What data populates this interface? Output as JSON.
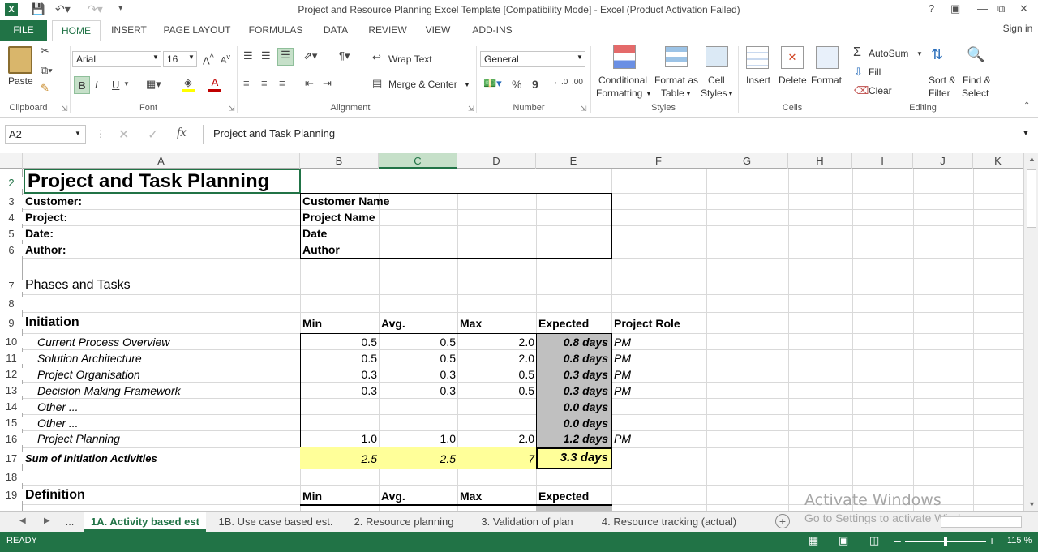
{
  "window": {
    "title": "Project and Resource Planning Excel Template  [Compatibility Mode] - Excel (Product Activation Failed)",
    "help": "?",
    "sign_in": "Sign in"
  },
  "ribbon_tabs": [
    "FILE",
    "HOME",
    "INSERT",
    "PAGE LAYOUT",
    "FORMULAS",
    "DATA",
    "REVIEW",
    "VIEW",
    "ADD-INS"
  ],
  "ribbon": {
    "paste": "Paste",
    "font_name": "Arial",
    "font_size": "16",
    "bold": "B",
    "italic": "I",
    "underline": "U",
    "wrap_text": "Wrap Text",
    "merge_center": "Merge & Center",
    "number_format": "General",
    "percent": "%",
    "comma": "9",
    "cond_fmt": [
      "Conditional",
      "Formatting"
    ],
    "fmt_table": [
      "Format as",
      "Table"
    ],
    "cell_styles": [
      "Cell",
      "Styles"
    ],
    "insert": "Insert",
    "delete": "Delete",
    "format": "Format",
    "autosum": "AutoSum",
    "fill": "Fill",
    "clear": "Clear",
    "sort_filter": [
      "Sort &",
      "Filter"
    ],
    "find_select": [
      "Find &",
      "Select"
    ],
    "groups": [
      "Clipboard",
      "Font",
      "Alignment",
      "Number",
      "Styles",
      "Cells",
      "Editing"
    ]
  },
  "formula_bar": {
    "name_box": "A2",
    "fx": "fx",
    "content": "Project and Task Planning"
  },
  "columns": [
    "A",
    "B",
    "C",
    "D",
    "E",
    "F",
    "G",
    "H",
    "I",
    "J",
    "K"
  ],
  "rows": [
    "2",
    "3",
    "4",
    "5",
    "6",
    "7",
    "8",
    "9",
    "10",
    "11",
    "12",
    "13",
    "14",
    "15",
    "16",
    "17",
    "18",
    "19"
  ],
  "sheet": {
    "title": "Project and Task Planning",
    "info_labels": [
      "Customer:",
      "Project:",
      "Date:",
      "Author:"
    ],
    "info_values": [
      "Customer Name",
      "Project Name",
      "Date",
      "Author"
    ],
    "phases_header": "Phases and Tasks",
    "initiation": "Initiation",
    "headers": {
      "min": "Min",
      "avg": "Avg.",
      "max": "Max",
      "expected": "Expected",
      "role": "Project Role"
    },
    "tasks": [
      {
        "name": "Current Process Overview",
        "min": "0.5",
        "avg": "0.5",
        "max": "2.0",
        "exp": "0.8 days",
        "role": "PM"
      },
      {
        "name": "Solution Architecture",
        "min": "0.5",
        "avg": "0.5",
        "max": "2.0",
        "exp": "0.8 days",
        "role": "PM"
      },
      {
        "name": "Project Organisation",
        "min": "0.3",
        "avg": "0.3",
        "max": "0.5",
        "exp": "0.3 days",
        "role": "PM"
      },
      {
        "name": "Decision Making Framework",
        "min": "0.3",
        "avg": "0.3",
        "max": "0.5",
        "exp": "0.3 days",
        "role": "PM"
      },
      {
        "name": "Other ...",
        "min": "",
        "avg": "",
        "max": "",
        "exp": "0.0 days",
        "role": ""
      },
      {
        "name": "Other ...",
        "min": "",
        "avg": "",
        "max": "",
        "exp": "0.0 days",
        "role": ""
      },
      {
        "name": "Project Planning",
        "min": "1.0",
        "avg": "1.0",
        "max": "2.0",
        "exp": "1.2 days",
        "role": "PM"
      }
    ],
    "sum": {
      "label": "Sum of Initiation Activities",
      "min": "2.5",
      "avg": "2.5",
      "max": "7",
      "exp": "3.3 days"
    },
    "definition": "Definition",
    "def_headers": {
      "min": "Min",
      "avg": "Avg.",
      "max": "Max",
      "expected": "Expected"
    }
  },
  "sheet_tabs": [
    "...",
    "1A. Activity based est",
    "1B. Use case based est.",
    "2. Resource planning",
    "3. Validation of plan",
    "4. Resource tracking (actual)"
  ],
  "watermark": [
    "Activate Windows",
    "Go to Settings to activate Windows."
  ],
  "status": {
    "ready": "READY",
    "zoom": "115 %"
  },
  "colors": {
    "accent": "#217346",
    "expected_fill": "#c0c0c0",
    "sum_fill": "#ffff99"
  }
}
